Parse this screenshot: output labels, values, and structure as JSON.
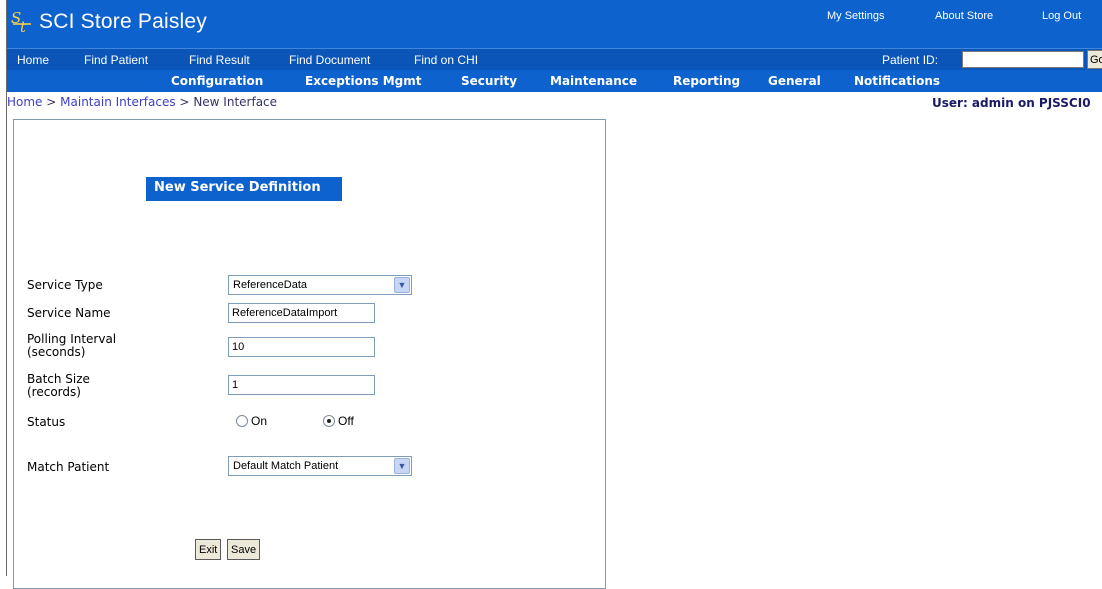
{
  "app": {
    "title": "SCI Store Paisley"
  },
  "top_links": [
    "My Settings",
    "About Store",
    "Log Out"
  ],
  "nav_primary": [
    "Home",
    "Find Patient",
    "Find Result",
    "Find Document",
    "Find on CHI"
  ],
  "patient_search": {
    "label": "Patient ID:",
    "value": "",
    "button": "Go"
  },
  "nav_secondary": [
    "Configuration",
    "Exceptions Mgmt",
    "Security",
    "Maintenance",
    "Reporting",
    "General",
    "Notifications"
  ],
  "breadcrumb": [
    "Home",
    "Maintain Interfaces",
    "New Interface"
  ],
  "breadcrumb_sep": ">",
  "user_info": "User: admin on PJSSCI0",
  "form": {
    "title": "New Service Definition",
    "service_type": {
      "label": "Service Type",
      "value": "ReferenceData"
    },
    "service_name": {
      "label": "Service Name",
      "value": "ReferenceDataImport"
    },
    "polling_interval": {
      "label_line1": "Polling Interval",
      "label_line2": "(seconds)",
      "value": "10"
    },
    "batch_size": {
      "label_line1": "Batch Size",
      "label_line2": "(records)",
      "value": "1"
    },
    "status": {
      "label": "Status",
      "on_label": "On",
      "off_label": "Off",
      "selected": "Off"
    },
    "match_patient": {
      "label": "Match Patient",
      "value": "Default Match Patient"
    },
    "buttons": {
      "exit": "Exit",
      "save": "Save"
    }
  },
  "colors": {
    "header_blue": "#0d62ce",
    "nav_dark_blue": "#0b55b8",
    "link_blue": "#3e3ec8",
    "button_face": "#ece9d8"
  }
}
